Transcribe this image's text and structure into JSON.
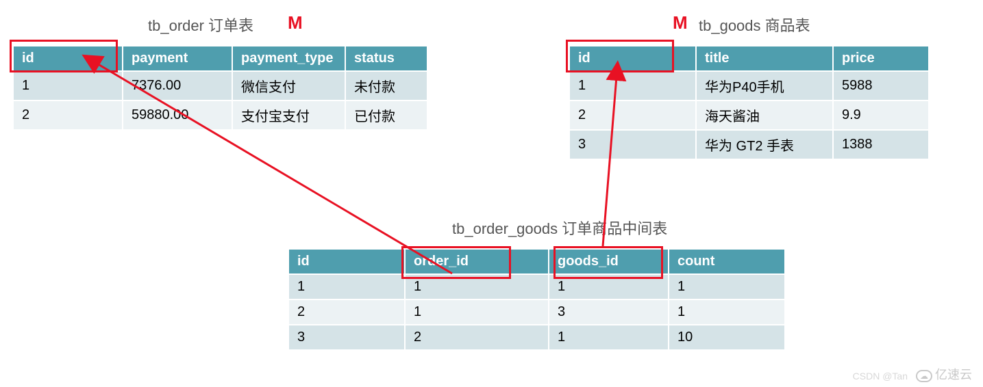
{
  "tables": {
    "order": {
      "title": "tb_order 订单表",
      "m": "M",
      "headers": [
        "id",
        "payment",
        "payment_type",
        "status"
      ],
      "rows": [
        [
          "1",
          "7376.00",
          "微信支付",
          "未付款"
        ],
        [
          "2",
          "59880.00",
          "支付宝支付",
          "已付款"
        ]
      ]
    },
    "goods": {
      "title": "tb_goods 商品表",
      "m": "M",
      "headers": [
        "id",
        "title",
        "price"
      ],
      "rows": [
        [
          "1",
          "华为P40手机",
          "5988"
        ],
        [
          "2",
          "海天酱油",
          "9.9"
        ],
        [
          "3",
          "华为 GT2 手表",
          "1388"
        ]
      ]
    },
    "order_goods": {
      "title": "tb_order_goods 订单商品中间表",
      "headers": [
        "id",
        "order_id",
        "goods_id",
        "count"
      ],
      "rows": [
        [
          "1",
          "1",
          "1",
          "1"
        ],
        [
          "2",
          "1",
          "3",
          "1"
        ],
        [
          "3",
          "2",
          "1",
          "10"
        ]
      ]
    }
  },
  "watermark": "CSDN @Tan",
  "logo_text": "亿速云"
}
